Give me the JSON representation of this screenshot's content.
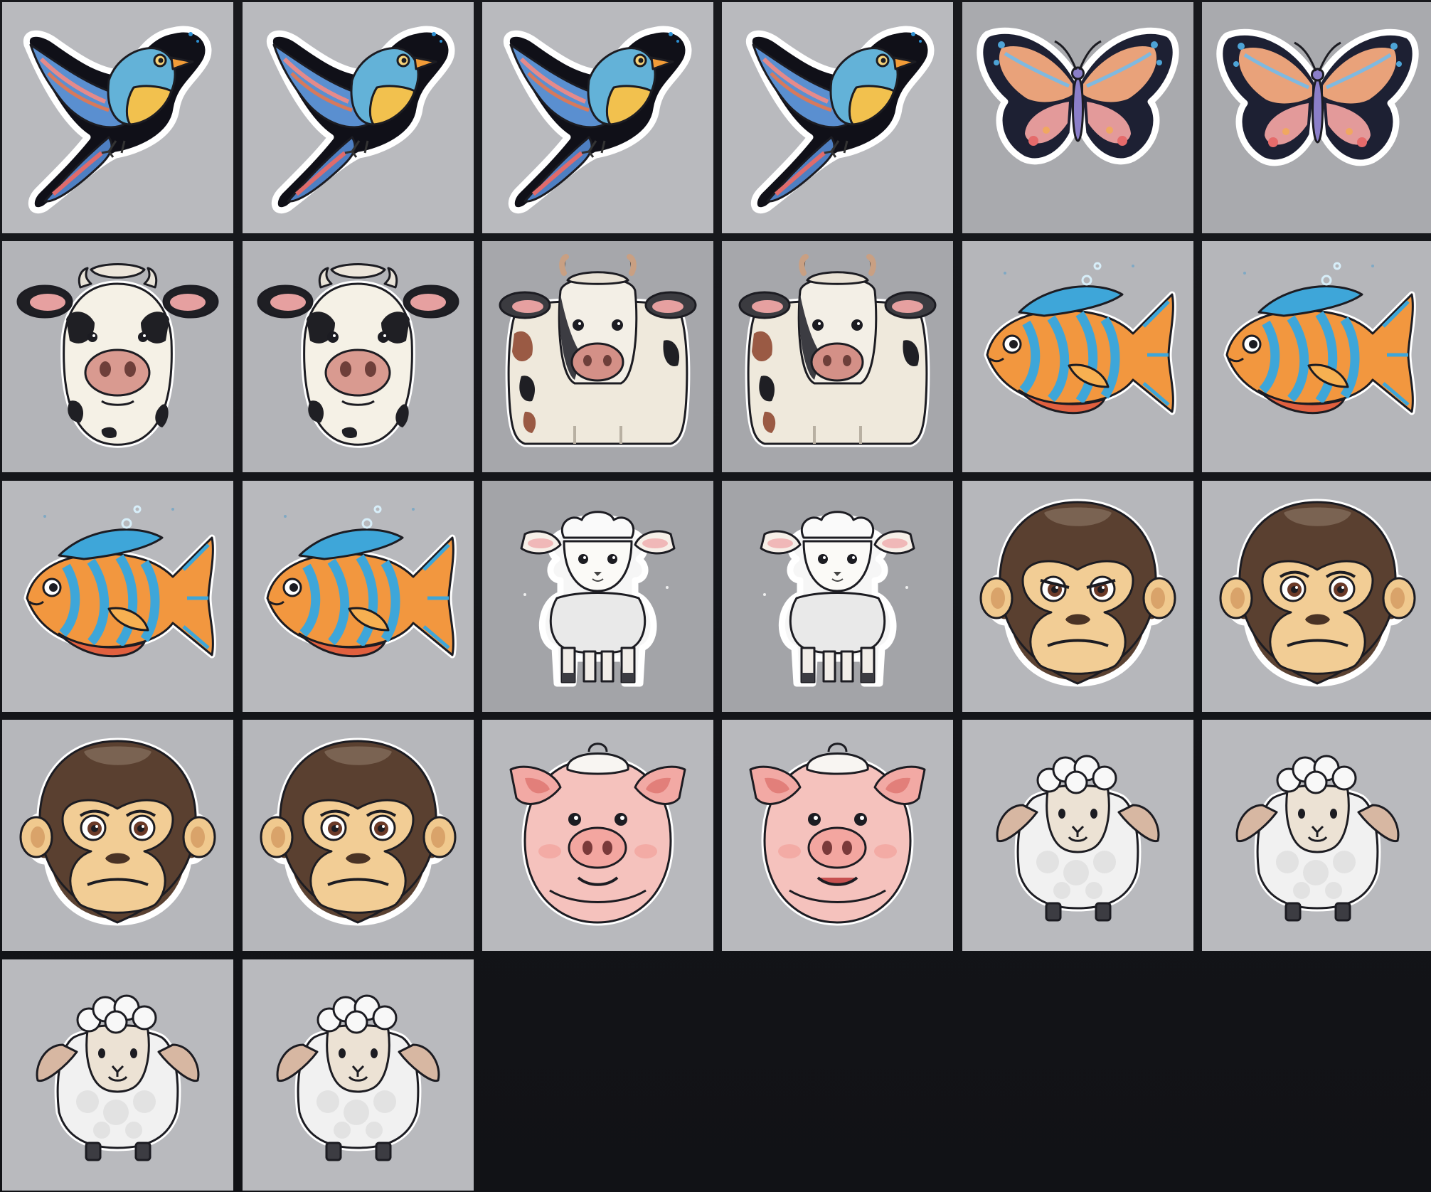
{
  "gallery": {
    "columns": 6,
    "background_color": "#141519",
    "items": [
      {
        "subject": "bird",
        "icon": "bird-sticker-icon",
        "variant": 1,
        "bg": "#b9babe"
      },
      {
        "subject": "bird",
        "icon": "bird-sticker-icon",
        "variant": 2,
        "bg": "#b9babe"
      },
      {
        "subject": "bird",
        "icon": "bird-sticker-icon",
        "variant": 3,
        "bg": "#b9babe"
      },
      {
        "subject": "bird",
        "icon": "bird-sticker-icon",
        "variant": 4,
        "bg": "#b9babe"
      },
      {
        "subject": "butterfly",
        "icon": "butterfly-sticker-icon",
        "variant": 1,
        "bg": "#a9aaae"
      },
      {
        "subject": "butterfly",
        "icon": "butterfly-sticker-icon",
        "variant": 2,
        "bg": "#a9aaae"
      },
      {
        "subject": "cow",
        "icon": "cow-head-sticker-icon",
        "variant": 1,
        "bg": "#b3b4b8"
      },
      {
        "subject": "cow",
        "icon": "cow-head-sticker-icon",
        "variant": 2,
        "bg": "#b3b4b8"
      },
      {
        "subject": "cow",
        "icon": "cow-body-sticker-icon",
        "variant": 1,
        "bg": "#a6a7ab"
      },
      {
        "subject": "cow",
        "icon": "cow-body-sticker-icon",
        "variant": 2,
        "bg": "#a6a7ab"
      },
      {
        "subject": "fish",
        "icon": "fish-sticker-icon",
        "variant": 1,
        "bg": "#b5b6ba"
      },
      {
        "subject": "fish",
        "icon": "fish-sticker-icon",
        "variant": 2,
        "bg": "#b5b6ba"
      },
      {
        "subject": "fish",
        "icon": "fish-sticker-icon",
        "variant": 3,
        "bg": "#b8b9bd"
      },
      {
        "subject": "fish",
        "icon": "fish-sticker-icon",
        "variant": 4,
        "bg": "#b8b9bd"
      },
      {
        "subject": "lamb",
        "icon": "lamb-sticker-icon",
        "variant": 1,
        "bg": "#a3a4a8"
      },
      {
        "subject": "lamb",
        "icon": "lamb-sticker-icon",
        "variant": 2,
        "bg": "#a3a4a8"
      },
      {
        "subject": "monkey",
        "icon": "monkey-face-sticker-icon",
        "variant": 1,
        "bg": "#b6b7bb"
      },
      {
        "subject": "monkey",
        "icon": "monkey-face-sticker-icon",
        "variant": 2,
        "bg": "#b6b7bb"
      },
      {
        "subject": "monkey",
        "icon": "monkey-face-sticker-icon",
        "variant": 3,
        "bg": "#b6b7bb"
      },
      {
        "subject": "monkey",
        "icon": "monkey-face-sticker-icon",
        "variant": 4,
        "bg": "#b6b7bb"
      },
      {
        "subject": "pig",
        "icon": "pig-face-sticker-icon",
        "variant": 1,
        "bg": "#b8b9bd"
      },
      {
        "subject": "pig",
        "icon": "pig-face-sticker-icon",
        "variant": 2,
        "bg": "#b8b9bd"
      },
      {
        "subject": "sheep",
        "icon": "sheep-sticker-icon",
        "variant": 1,
        "bg": "#b9babe"
      },
      {
        "subject": "sheep",
        "icon": "sheep-sticker-icon",
        "variant": 2,
        "bg": "#b9babe"
      },
      {
        "subject": "sheep",
        "icon": "sheep-sticker-icon",
        "variant": 3,
        "bg": "#b9babe"
      },
      {
        "subject": "sheep",
        "icon": "sheep-sticker-icon",
        "variant": 4,
        "bg": "#b9babe"
      }
    ]
  }
}
